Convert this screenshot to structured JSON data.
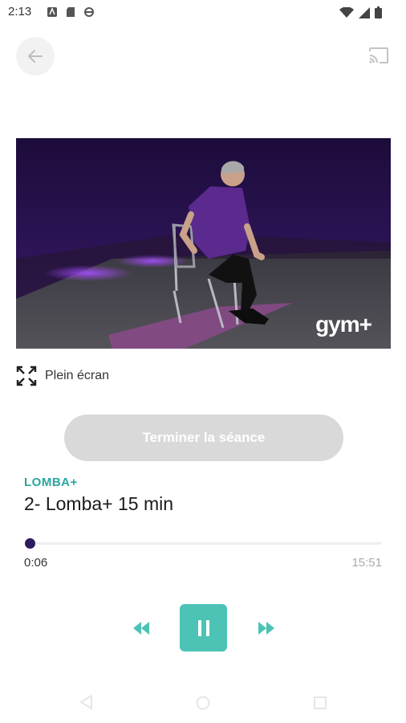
{
  "status_bar": {
    "time": "2:13"
  },
  "video": {
    "brand_logo_text": "gym+"
  },
  "fullscreen": {
    "label": "Plein écran"
  },
  "finish_button": {
    "label": "Terminer la séance"
  },
  "session": {
    "category": "LOMBA+",
    "title": "2- Lomba+ 15 min"
  },
  "player": {
    "current_time": "0:06",
    "total_time": "15:51",
    "progress_fraction": 0.006
  },
  "colors": {
    "accent": "#4cc3b5",
    "category_text": "#2aa6a0",
    "progress": "#2d1b5e",
    "disabled_button": "#d9d9d9"
  }
}
